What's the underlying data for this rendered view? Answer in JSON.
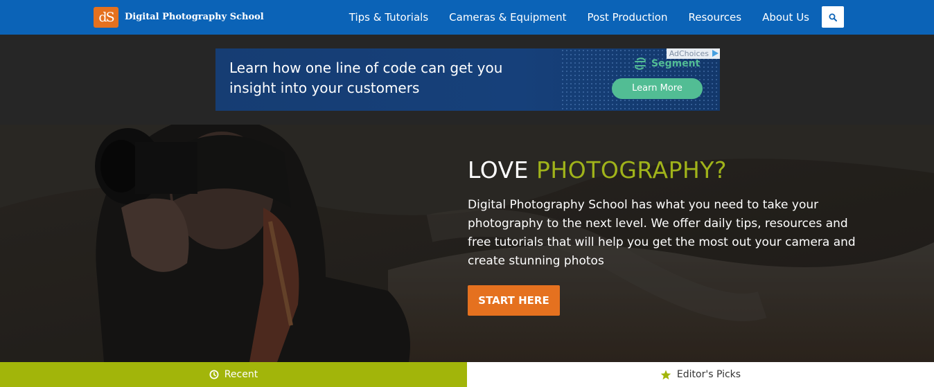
{
  "header": {
    "logo_mark": "dS",
    "site_name": "Digital Photography School",
    "nav": [
      {
        "label": "Tips & Tutorials"
      },
      {
        "label": "Cameras & Equipment"
      },
      {
        "label": "Post Production"
      },
      {
        "label": "Resources"
      },
      {
        "label": "About Us"
      }
    ],
    "search_icon": "search-icon"
  },
  "ad": {
    "headline": "Learn how one line of code can get you insight into your customers",
    "brand": "Segment",
    "cta_label": "Learn More",
    "adchoices_label": "AdChoices"
  },
  "hero": {
    "title_plain": "LOVE",
    "title_accent": "PHOTOGRAPHY?",
    "description": "Digital Photography School has what you need to take your photography to the next level. We offer daily tips, resources and free tutorials that will help you get the most out your camera and create stunning photos",
    "cta_label": "START HERE"
  },
  "tabs": [
    {
      "label": "Recent",
      "icon": "clock-icon",
      "active": true
    },
    {
      "label": "Editor's Picks",
      "icon": "star-icon",
      "active": false
    }
  ],
  "colors": {
    "nav_blue": "#0b63b7",
    "brand_orange": "#e5711f",
    "accent_green": "#a0b31a",
    "tab_green": "#a2b50a",
    "segment_green": "#52bd94"
  }
}
